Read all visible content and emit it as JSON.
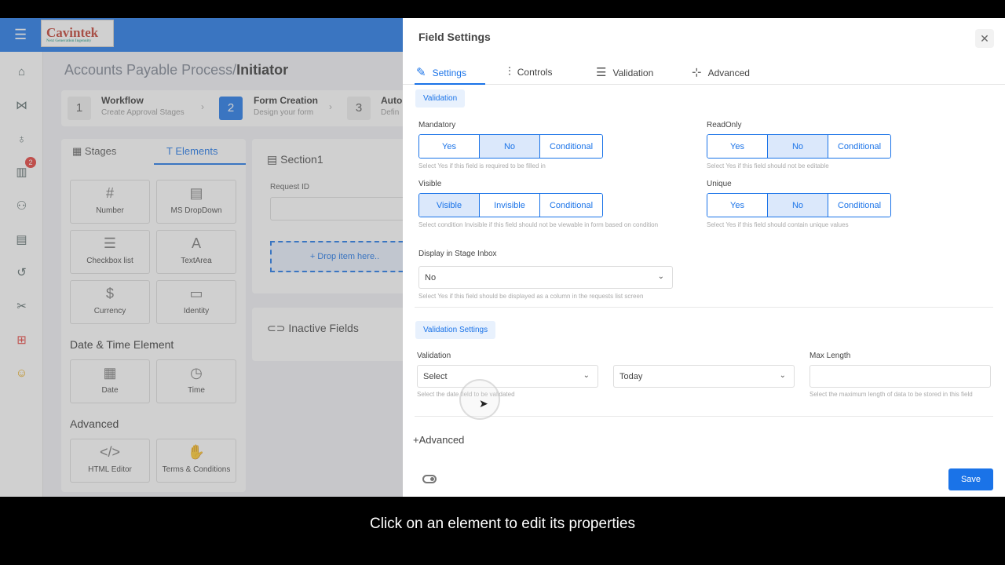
{
  "app": {
    "logo": "Cavintek",
    "logo_tag": "Next Generation Ingenuity",
    "notification_count": "2"
  },
  "breadcrumb": {
    "path": "Accounts Payable Process/",
    "current": "Initiator"
  },
  "steps": [
    {
      "num": "1",
      "title": "Workflow",
      "sub": "Create Approval Stages"
    },
    {
      "num": "2",
      "title": "Form Creation",
      "sub": "Design your form"
    },
    {
      "num": "3",
      "title": "Auto",
      "sub": "Defin"
    }
  ],
  "elements_panel": {
    "tabs": [
      "Stages",
      "Elements"
    ],
    "tiles": [
      {
        "icon": "#",
        "label": "Number"
      },
      {
        "icon": "▤",
        "label": "MS DropDown"
      },
      {
        "icon": "☰",
        "label": "Checkbox list"
      },
      {
        "icon": "A",
        "label": "TextArea"
      },
      {
        "icon": "$",
        "label": "Currency"
      },
      {
        "icon": "▭",
        "label": "Identity"
      },
      {
        "icon": "▦",
        "label": "Date"
      },
      {
        "icon": "◷",
        "label": "Time"
      },
      {
        "icon": "</>",
        "label": "HTML Editor"
      },
      {
        "icon": "✋",
        "label": "Terms & Conditions"
      }
    ],
    "groups": [
      "Date & Time Element",
      "Advanced"
    ]
  },
  "section": {
    "title": "Section1",
    "field_label": "Request ID",
    "drop_text": "+ Drop item here..",
    "inactive": "Inactive Fields"
  },
  "drawer": {
    "title": "Field Settings",
    "tabs": [
      "Settings",
      "Controls",
      "Validation",
      "Advanced"
    ],
    "validation_pill": "Validation",
    "mandatory": {
      "label": "Mandatory",
      "options": [
        "Yes",
        "No",
        "Conditional"
      ],
      "selected": "No",
      "hint": "Select Yes if this field is required to be filled in"
    },
    "readonly": {
      "label": "ReadOnly",
      "options": [
        "Yes",
        "No",
        "Conditional"
      ],
      "selected": "No",
      "hint": "Select Yes if this field should not be editable"
    },
    "visible": {
      "label": "Visible",
      "options": [
        "Visible",
        "Invisible",
        "Conditional"
      ],
      "selected": "Visible",
      "hint": "Select condition Invisible if this field should not be viewable in form based on condition"
    },
    "unique": {
      "label": "Unique",
      "options": [
        "Yes",
        "No",
        "Conditional"
      ],
      "selected": "No",
      "hint": "Select Yes if this field should contain unique values"
    },
    "stage_inbox": {
      "label": "Display in Stage Inbox",
      "value": "No",
      "hint": "Select Yes if this field should be displayed as a column in the requests list screen"
    },
    "validation_settings_pill": "Validation Settings",
    "validation": {
      "label": "Validation",
      "value": "Select",
      "second_value": "Today",
      "hint": "Select the date field to be validated"
    },
    "max_length": {
      "label": "Max Length",
      "value": "",
      "hint": "Select the maximum length of data to be stored in this field"
    },
    "advanced": "+Advanced",
    "save": "Save"
  },
  "caption": "Click on an element to edit its properties"
}
